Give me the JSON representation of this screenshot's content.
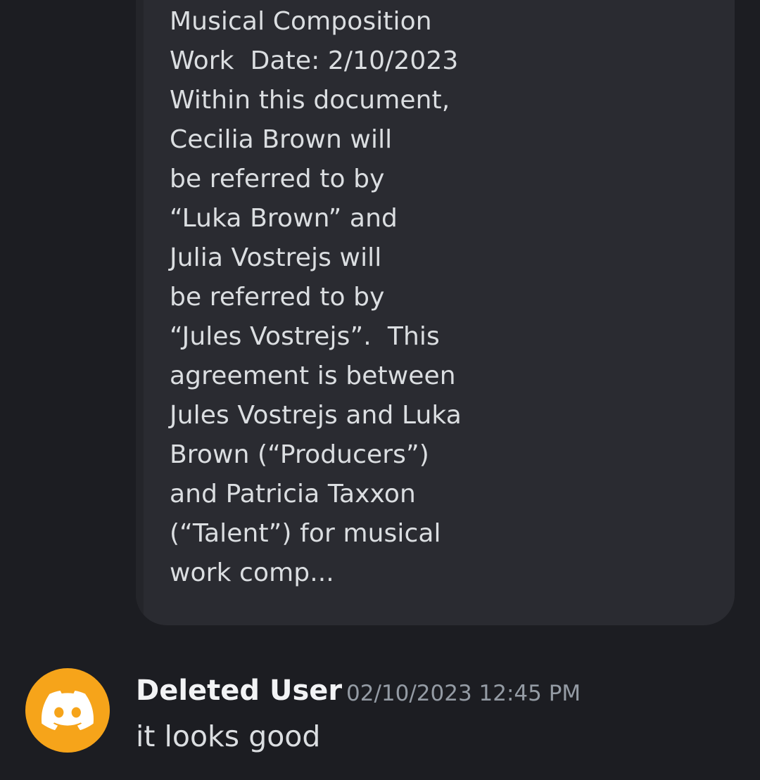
{
  "embed": {
    "lines": [
      "Musical Composition",
      "Work  Date: 2/10/2023",
      "Within this document,",
      "Cecilia Brown will",
      "be referred to by",
      "“Luka Brown” and",
      "Julia Vostrejs will",
      "be referred to by",
      "“Jules Vostrejs”.  This",
      "agreement is between",
      "Jules Vostrejs and Luka",
      "Brown (“Producers”)",
      "and Patricia Taxxon",
      "(“Talent”) for musical",
      "work comp..."
    ]
  },
  "message": {
    "avatar_icon": "discord-logo-icon",
    "avatar_color": "#f6a41a",
    "username": "Deleted User",
    "timestamp": "02/10/2023 12:45 PM",
    "content": "it looks good"
  }
}
